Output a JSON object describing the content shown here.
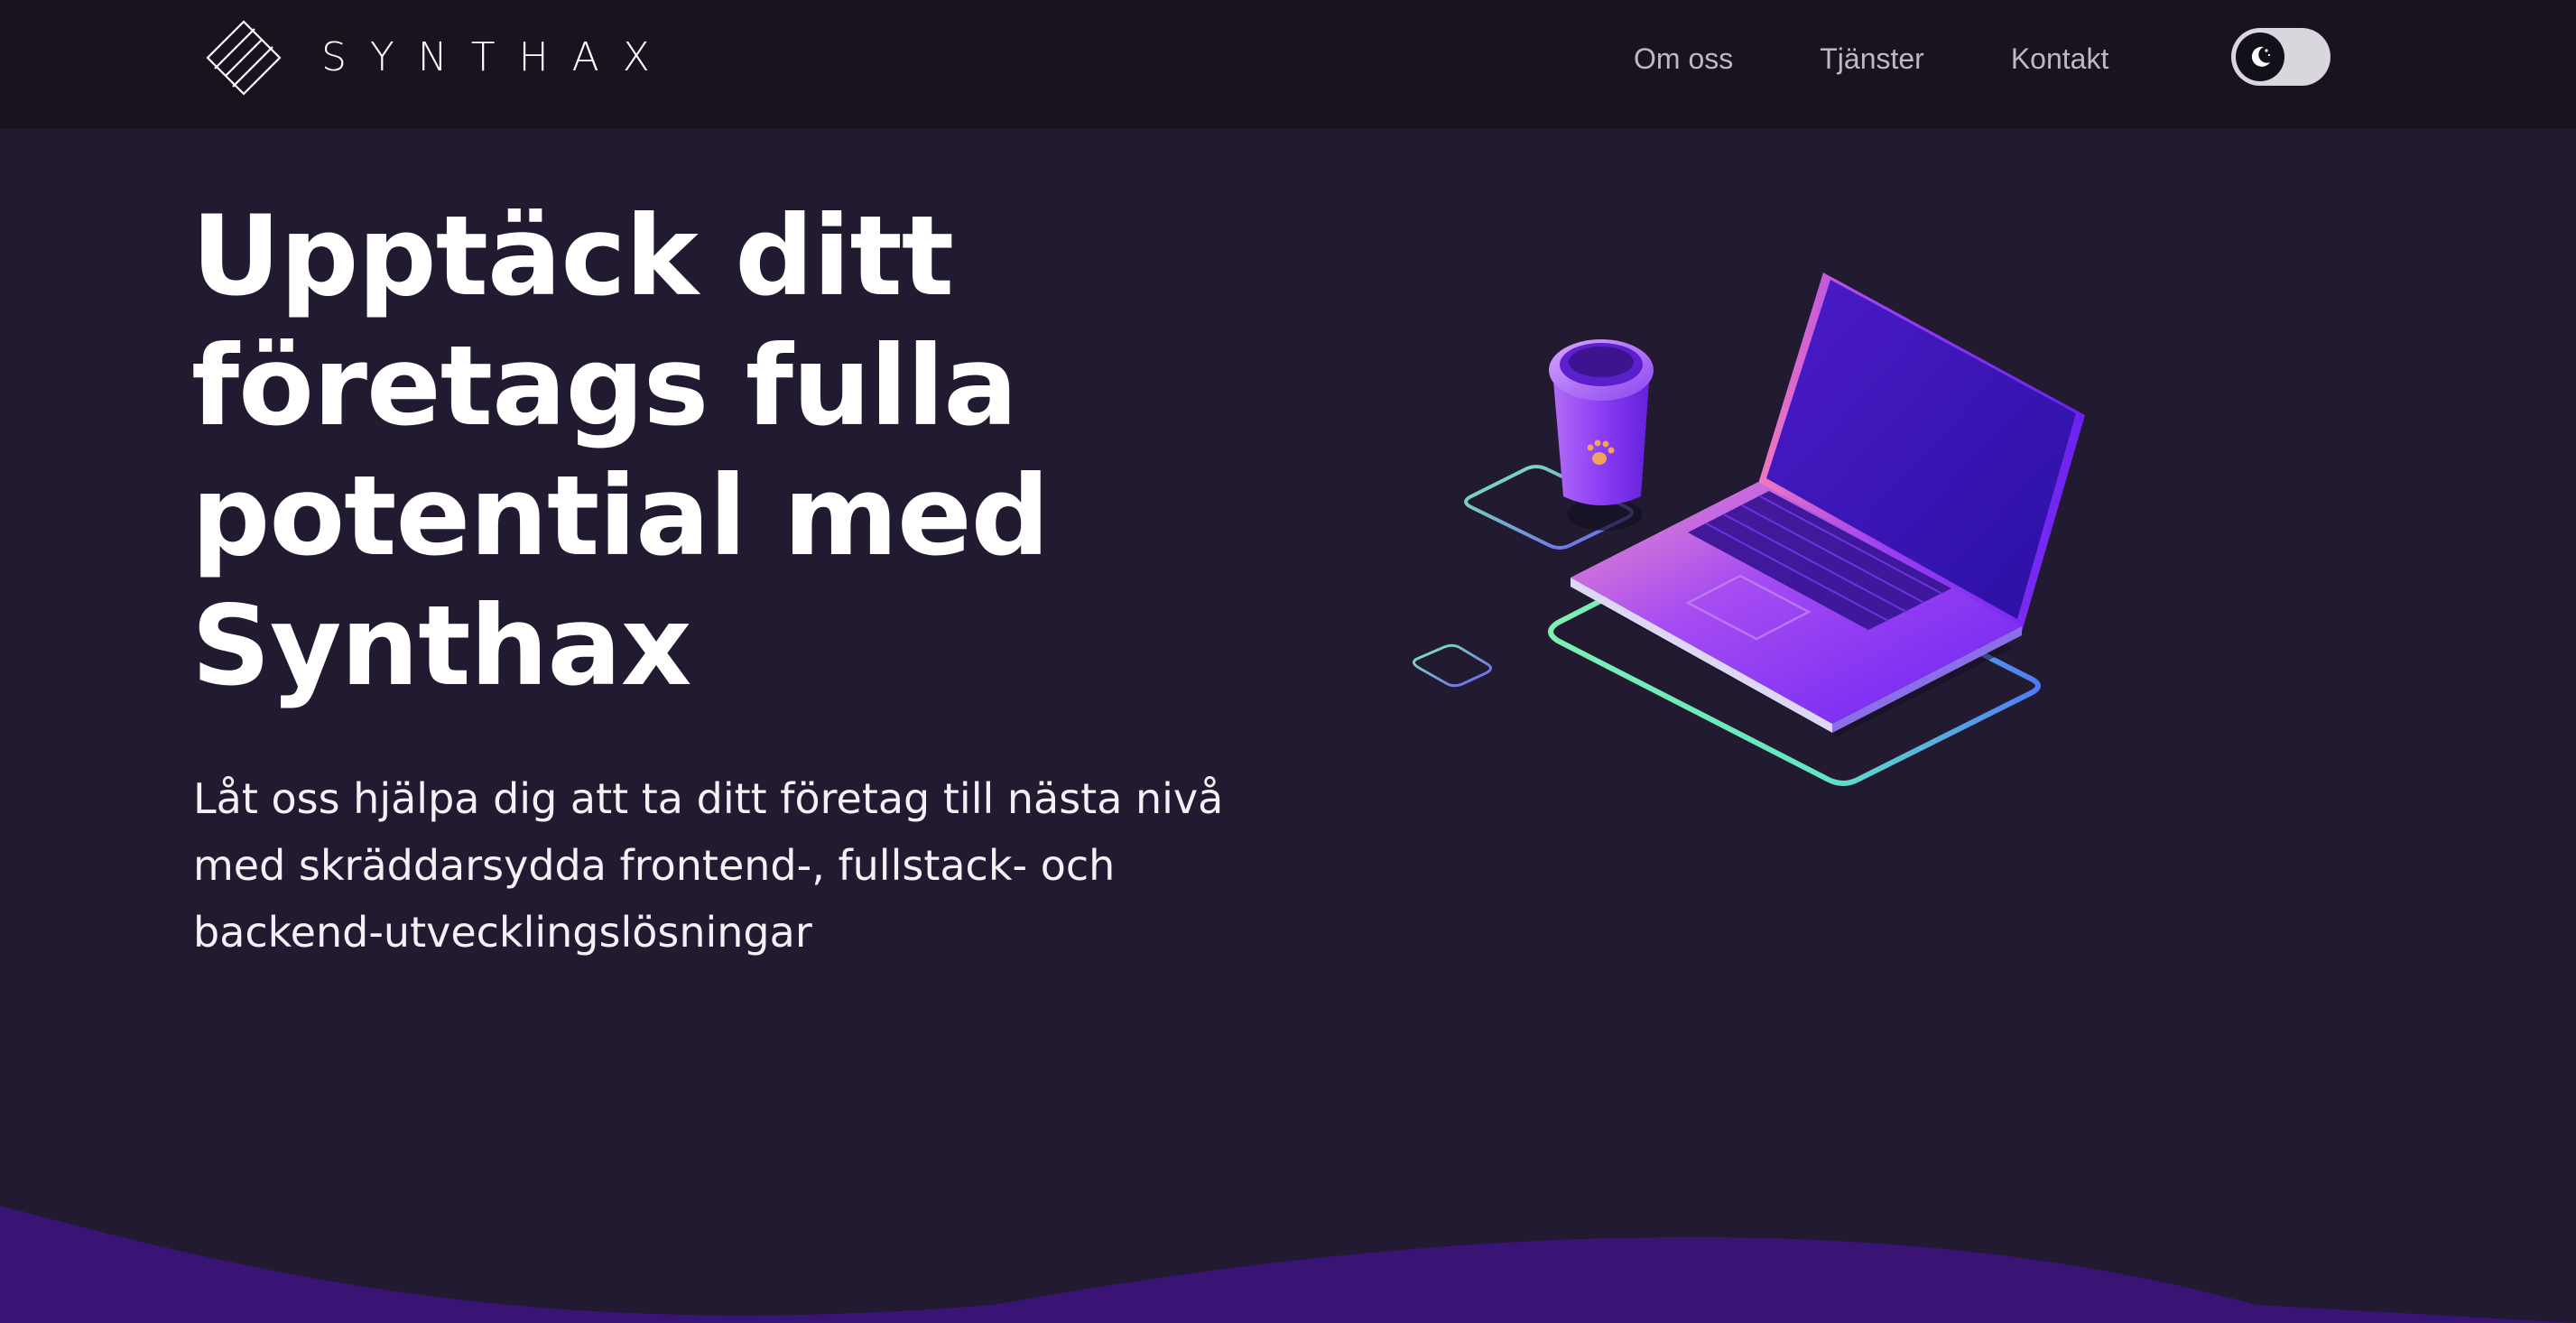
{
  "brand": {
    "name": "SYNTHAX"
  },
  "nav": {
    "links": [
      {
        "label": "Om oss"
      },
      {
        "label": "Tjänster"
      },
      {
        "label": "Kontakt"
      }
    ],
    "theme_toggle": {
      "icon": "moon-icon",
      "mode": "dark"
    }
  },
  "hero": {
    "title": "Upptäck ditt företags fulla potential med Synthax",
    "subtitle": "Låt oss hjälpa dig att ta ditt företag till nästa nivå med skräddarsydda frontend-, fullstack- och backend-utvecklingslösningar",
    "illustration": "laptop-coffee-illustration"
  },
  "colors": {
    "background": "#211a30",
    "navbar": "#19131f",
    "nav_link": "#bdb8c6",
    "accent_purple": "#7b2ff7",
    "wave": "#3a1475"
  }
}
